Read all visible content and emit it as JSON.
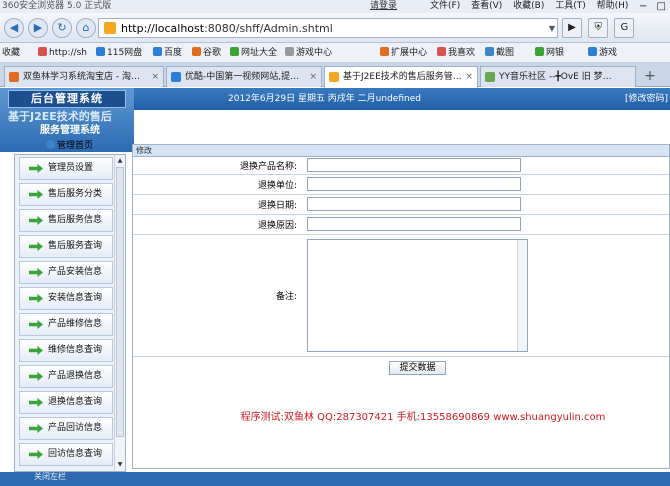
{
  "browser": {
    "title": "360安全浏览器 5.0 正式版",
    "login": "请登录",
    "menu": [
      "文件(F)",
      "查看(V)",
      "收藏(B)",
      "工具(T)",
      "帮助(H)"
    ],
    "url_host": "http://localhost",
    "url_rest": ":8080/shff/Admin.shtml",
    "favorites": [
      "收藏",
      "http://sh",
      "115网盘",
      "百度",
      "谷歌",
      "网址大全",
      "游戏中心",
      "扩展中心",
      "我喜欢",
      "截图",
      "网银",
      "游戏"
    ],
    "tabs": [
      {
        "label": "双鱼林学习系统淘宝店 - 淘…",
        "color": "#e26b1d"
      },
      {
        "label": "优酷-中国第一视频网站,提…",
        "color": "#2c7fd6"
      },
      {
        "label": "基于J2EE技术的售后服务管…",
        "color": "#f5a623"
      },
      {
        "label": "YY音乐社区 --╋OvE 旧 梦…",
        "color": "#6aa84f"
      }
    ]
  },
  "header": {
    "logo": "后台管理系统",
    "system_title_line1": "基于J2EE技术的售后",
    "system_title_line2": "服务管理系统",
    "date": "2012年6月29日 星期五 丙戌年 二月undefined",
    "password_link": "[修改密码]",
    "home_link": "管理首页"
  },
  "sidebar": {
    "items": [
      "管理员设置",
      "售后服务分类",
      "售后服务信息",
      "售后服务查询",
      "产品安装信息",
      "安装信息查询",
      "产品维修信息",
      "维修信息查询",
      "产品退换信息",
      "退换信息查询",
      "产品回访信息",
      "回访信息查询"
    ]
  },
  "form": {
    "panel_title": "修改",
    "fields": {
      "product_name": {
        "label": "退换产品名称:",
        "value": ""
      },
      "unit": {
        "label": "退换单位:",
        "value": ""
      },
      "date": {
        "label": "退换日期:",
        "value": ""
      },
      "reason": {
        "label": "退换原因:",
        "value": ""
      },
      "note": {
        "label": "备注:",
        "value": ""
      }
    },
    "submit_label": "提交数据"
  },
  "footer_text": "程序测试:双鱼林 QQ:287307421 手机:13558690869 www.shuangyulin.com",
  "bottom_label": "关闭左栏"
}
